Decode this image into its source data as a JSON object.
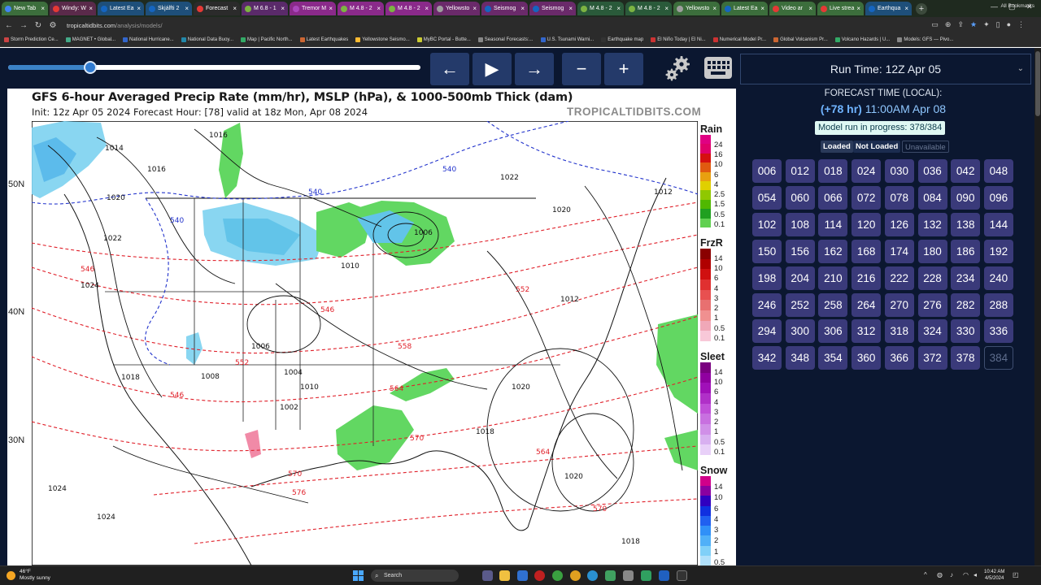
{
  "browser": {
    "tabs": [
      {
        "label": "New Tab",
        "color": "#3c6e3c",
        "fav": "#4285f4"
      },
      {
        "label": "Windy: W",
        "color": "#5a2a4a",
        "fav": "#e53935"
      },
      {
        "label": "Latest Ea",
        "color": "#1e4f7a",
        "fav": "#1565c0"
      },
      {
        "label": "Skjálfti 2",
        "color": "#1e4f7a",
        "fav": "#1565c0"
      },
      {
        "label": "Forecast",
        "color": "#2b2b2b",
        "fav": "#e53935"
      },
      {
        "label": "M 6.8 - 1",
        "color": "#5a2a6a",
        "fav": "#7cb342"
      },
      {
        "label": "Tremor M",
        "color": "#8a2a8a",
        "fav": "#ab47bc"
      },
      {
        "label": "M 4.8 - 2",
        "color": "#8a2a8a",
        "fav": "#7cb342"
      },
      {
        "label": "M 4.8 - 2",
        "color": "#8a2a8a",
        "fav": "#7cb342"
      },
      {
        "label": "Yellowsto",
        "color": "#6a2a6a",
        "fav": "#9e9e9e"
      },
      {
        "label": "Seismog",
        "color": "#6a2a6a",
        "fav": "#1565c0"
      },
      {
        "label": "Seismog",
        "color": "#6a2a6a",
        "fav": "#1565c0"
      },
      {
        "label": "M 4.8 - 2",
        "color": "#2a5a3a",
        "fav": "#7cb342"
      },
      {
        "label": "M 4.8 - 2",
        "color": "#2a5a3a",
        "fav": "#7cb342"
      },
      {
        "label": "Yellowsto",
        "color": "#3c6e3c",
        "fav": "#9e9e9e"
      },
      {
        "label": "Latest Ea",
        "color": "#3c6e3c",
        "fav": "#1565c0"
      },
      {
        "label": "Video ar",
        "color": "#3c6e3c",
        "fav": "#e53935"
      },
      {
        "label": "Live strea",
        "color": "#3c6e3c",
        "fav": "#e53935"
      },
      {
        "label": "Earthqua",
        "color": "#1e4f7a",
        "fav": "#1565c0"
      }
    ],
    "url_host": "tropicaltidbits.com",
    "url_path": "/analysis/models/",
    "bookmarks": [
      "Storm Prediction Ce...",
      "MAGNET • Global...",
      "National Hurricane...",
      "National Data Buoy...",
      "Map | Pacific North...",
      "Latest Earthquakes",
      "Yellowstone Seismo...",
      "MyBC Portal - Butte...",
      "Seasonal Forecasts:...",
      "U.S. Tsunami Warni...",
      "Earthquake map",
      "El Niño Today | El Ni...",
      "Numerical Model Pr...",
      "Global Volcanism Pr...",
      "Volcano Hazards | U...",
      "Models: GFS — Pivo..."
    ],
    "all_bookmarks": "All Bookmarks"
  },
  "controls": {
    "slider_fraction": 0.2,
    "prev_icon": "←",
    "play_icon": "▶",
    "next_icon": "→",
    "zoom_out_icon": "−",
    "zoom_in_icon": "+"
  },
  "run": {
    "run_time": "Run Time: 12Z Apr 05",
    "forecast_label": "FORECAST TIME (LOCAL):",
    "forecast_hour": "(+78 hr)",
    "forecast_time": "11:00AM Apr 08",
    "progress": "Model run in progress: 378/384",
    "legend_loaded": "Loaded",
    "legend_not_loaded": "Not Loaded",
    "legend_unavailable": "Unavailable"
  },
  "hours": [
    "006",
    "012",
    "018",
    "024",
    "030",
    "036",
    "042",
    "048",
    "054",
    "060",
    "066",
    "072",
    "078",
    "084",
    "090",
    "096",
    "102",
    "108",
    "114",
    "120",
    "126",
    "132",
    "138",
    "144",
    "150",
    "156",
    "162",
    "168",
    "174",
    "180",
    "186",
    "192",
    "198",
    "204",
    "210",
    "216",
    "222",
    "228",
    "234",
    "240",
    "246",
    "252",
    "258",
    "264",
    "270",
    "276",
    "282",
    "288",
    "294",
    "300",
    "306",
    "312",
    "318",
    "324",
    "330",
    "336",
    "342",
    "348",
    "354",
    "360",
    "366",
    "372",
    "378",
    "384"
  ],
  "unavailable_hour": "384",
  "map": {
    "title": "GFS 6-hour Averaged Precip Rate (mm/hr), MSLP (hPa), & 1000-500mb Thick (dam)",
    "subtitle": "Init: 12z Apr 05 2024   Forecast Hour: [78]   valid at 18z Mon, Apr 08 2024",
    "credit": "TROPICALTIDBITS.COM",
    "lat_labels": [
      "50N",
      "40N",
      "30N"
    ],
    "pressure_labels": [
      "1014",
      "1016",
      "1012",
      "1020",
      "1022",
      "1024",
      "1008",
      "1006",
      "1004",
      "1002",
      "1010",
      "1018"
    ],
    "thickness_labels": [
      "540",
      "546",
      "552",
      "558",
      "564",
      "570",
      "576"
    ],
    "legends": [
      {
        "name": "Rain",
        "ticks": [
          "24",
          "16",
          "10",
          "6",
          "4",
          "2.5",
          "1.5",
          "0.5",
          "0.1"
        ],
        "colors": [
          "#e00083",
          "#e0006a",
          "#d51010",
          "#e05a10",
          "#e8a010",
          "#e0d000",
          "#90c800",
          "#50b800",
          "#20a020",
          "#60d050"
        ]
      },
      {
        "name": "FrzR",
        "ticks": [
          "14",
          "10",
          "6",
          "4",
          "3",
          "2",
          "1",
          "0.5",
          "0.1"
        ],
        "colors": [
          "#8a0000",
          "#b00000",
          "#d01010",
          "#e03030",
          "#e85050",
          "#e87070",
          "#f09090",
          "#f0a8b8",
          "#f8c8d8"
        ]
      },
      {
        "name": "Sleet",
        "ticks": [
          "14",
          "10",
          "6",
          "4",
          "3",
          "2",
          "1",
          "0.5",
          "0.1"
        ],
        "colors": [
          "#7a0080",
          "#9000a0",
          "#a010b8",
          "#b030c8",
          "#c050d8",
          "#c870e0",
          "#d090e8",
          "#d8b0f0",
          "#e8d0f8"
        ]
      },
      {
        "name": "Snow",
        "ticks": [
          "14",
          "10",
          "6",
          "4",
          "3",
          "2",
          "1",
          "0.5"
        ],
        "colors": [
          "#d0008a",
          "#8a00a0",
          "#3000c0",
          "#1030e0",
          "#2060f0",
          "#3090f8",
          "#50b0f8",
          "#80d0f8",
          "#b0e0fa"
        ]
      }
    ]
  },
  "taskbar": {
    "temp": "46°F",
    "condition": "Mostly sunny",
    "search": "Search",
    "time": "10:42 AM",
    "date": "4/5/2024"
  }
}
